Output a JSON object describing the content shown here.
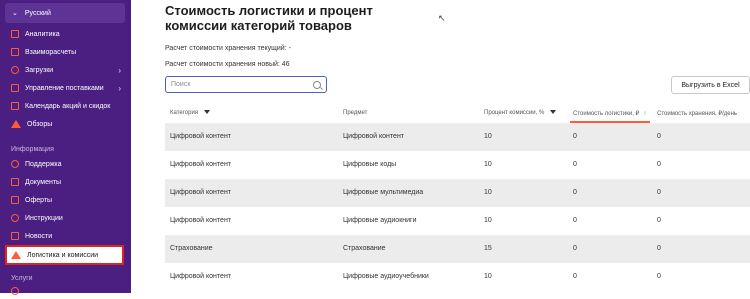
{
  "sidebar": {
    "language": "Русский",
    "items": [
      {
        "label": "Аналитика",
        "icon": "analytics-icon"
      },
      {
        "label": "Взаиморасчеты",
        "icon": "settlements-icon"
      },
      {
        "label": "Загрузки",
        "icon": "upload-icon",
        "has_arrow": true
      },
      {
        "label": "Управление поставками",
        "icon": "supply-icon",
        "has_arrow": true
      },
      {
        "label": "Календарь акций и скидок",
        "icon": "calendar-icon"
      },
      {
        "label": "Обзоры",
        "icon": "reviews-icon"
      }
    ],
    "info_section_label": "Информация",
    "info_items": [
      {
        "label": "Поддержка",
        "icon": "support-icon"
      },
      {
        "label": "Документы",
        "icon": "documents-icon"
      },
      {
        "label": "Оферты",
        "icon": "offers-icon"
      },
      {
        "label": "Инструкции",
        "icon": "instructions-icon"
      },
      {
        "label": "Новости",
        "icon": "news-icon"
      },
      {
        "label": "Логистика и комиссии",
        "icon": "megaphone-icon",
        "active": true
      }
    ],
    "services_section_label": "Услуги"
  },
  "main": {
    "title": "Стоимость логистики и процент комиссии категорий товаров",
    "storage_current": "Расчет стоимости хранения текущий: -",
    "storage_new": "Расчет стоимости хранения новый: 46",
    "search_placeholder": "Поиск",
    "export_label": "Выгрузить в Excel"
  },
  "table": {
    "headers": [
      "Категория",
      "Предмет",
      "Процент комиссии, %",
      "Стоимость логистики, ₽",
      "Стоимость хранения, ₽/день"
    ],
    "rows": [
      [
        "Цифровой контент",
        "Цифровой контент",
        "10",
        "0",
        "0"
      ],
      [
        "Цифровой контент",
        "Цифровые коды",
        "10",
        "0",
        "0"
      ],
      [
        "Цифровой контент",
        "Цифровые мультимедиа",
        "10",
        "0",
        "0"
      ],
      [
        "Цифровой контент",
        "Цифровые аудиокниги",
        "10",
        "0",
        "0"
      ],
      [
        "Страхование",
        "Страхование",
        "15",
        "0",
        "0"
      ],
      [
        "Цифровой контент",
        "Цифровые аудиоучебники",
        "10",
        "0",
        "0"
      ]
    ]
  },
  "colors": {
    "sidebar": "#4b1f82",
    "accent": "#ff5a3c",
    "active_border": "#e02424"
  }
}
